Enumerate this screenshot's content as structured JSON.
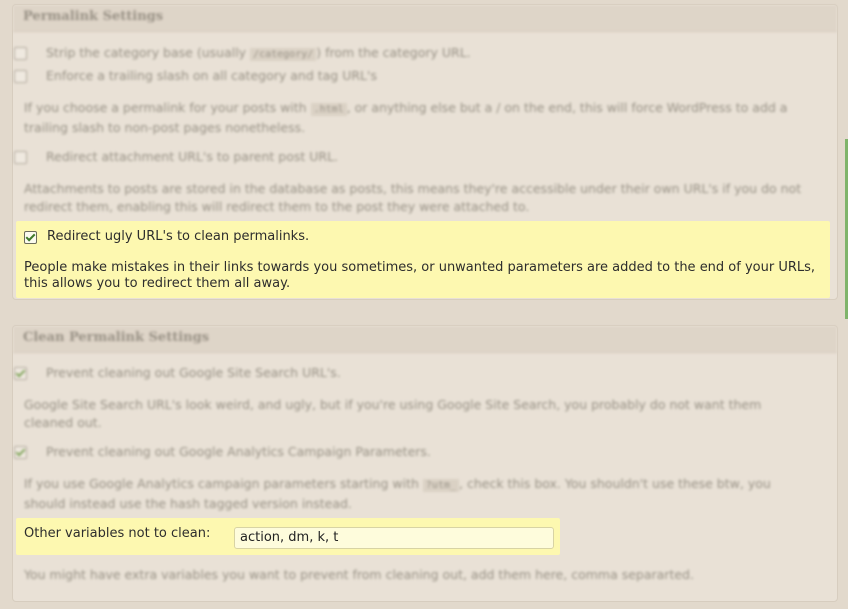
{
  "permalink_panel": {
    "title": "Permalink Settings",
    "strip_category_base": {
      "label_before": "Strip the category base (usually",
      "code": "/category/",
      "label_after": ") from the category URL.",
      "checked": false
    },
    "trailing_slash": {
      "label": "Enforce a trailing slash on all category and tag URL's",
      "checked": false
    },
    "trailing_slash_help": {
      "before": "If you choose a permalink for your posts with",
      "code": ".html",
      "after": ", or anything else but a / on the end, this will force WordPress to add a trailing slash to non-post pages nonetheless."
    },
    "redirect_attachment": {
      "label": "Redirect attachment URL's to parent post URL.",
      "checked": false
    },
    "redirect_attachment_help": "Attachments to posts are stored in the database as posts, this means they're accessible under their own URL's if you do not redirect them, enabling this will redirect them to the post they were attached to.",
    "redirect_ugly": {
      "label": "Redirect ugly URL's to clean permalinks.",
      "checked": true,
      "help": "People make mistakes in their links towards you sometimes, or unwanted parameters are added to the end of your URLs, this allows you to redirect them all away."
    }
  },
  "clean_panel": {
    "title": "Clean Permalink Settings",
    "prevent_gss": {
      "label": "Prevent cleaning out Google Site Search URL's.",
      "checked": true
    },
    "prevent_gss_help": "Google Site Search URL's look weird, and ugly, but if you're using Google Site Search, you probably do not want them cleaned out.",
    "prevent_ga": {
      "label": "Prevent cleaning out Google Analytics Campaign Parameters.",
      "checked": true
    },
    "prevent_ga_help": {
      "before": "If you use Google Analytics campaign parameters starting with",
      "code": "?utm_",
      "after": ", check this box. You shouldn't use these btw, you should instead use the hash tagged version instead."
    },
    "other_vars": {
      "label": "Other variables not to clean:",
      "value": "action, dm, k, t"
    },
    "other_vars_help": "You might have extra variables you want to prevent from cleaning out, add them here, comma separarted."
  }
}
